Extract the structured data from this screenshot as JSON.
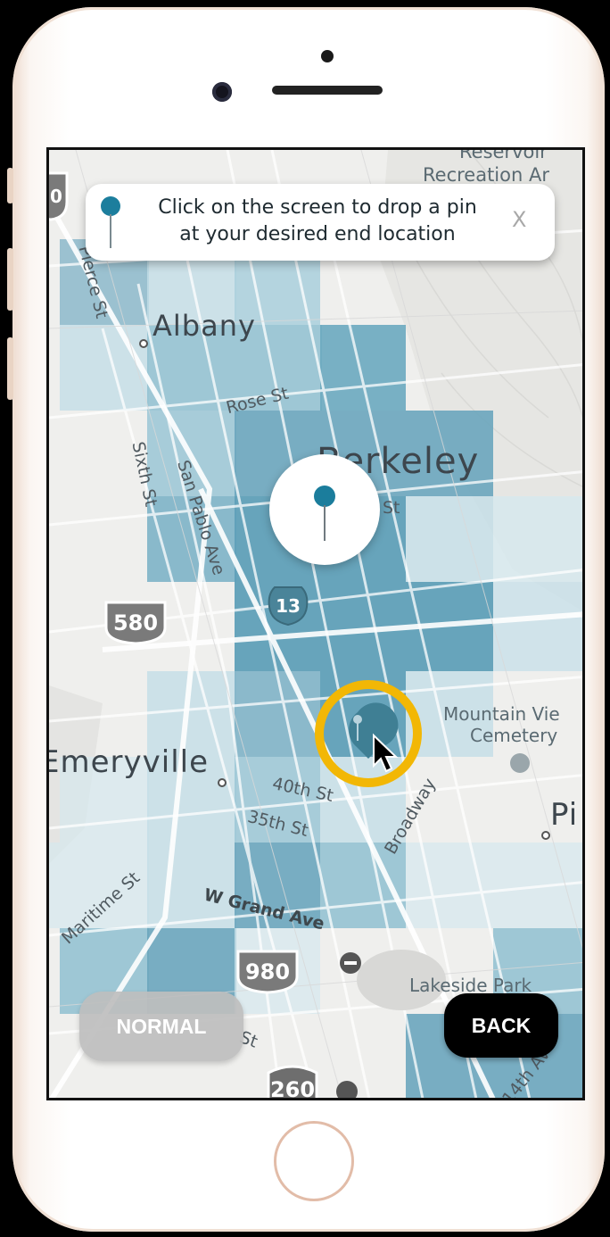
{
  "instruction": {
    "line1": "Click on the screen to drop a pin",
    "line2": "at your desired end location",
    "close_label": "X"
  },
  "map": {
    "cities": {
      "albany": "Albany",
      "berkeley": "Berkeley",
      "emeryville": "Emeryville",
      "piedmont": "Pi"
    },
    "streets": {
      "pierce": "Pierce St",
      "rose": "Rose St",
      "sixth": "Sixth St",
      "san_pablo": "San Pablo Ave",
      "st_fragment": "St",
      "fortieth": "40th St",
      "thirtyfifth": "35th St",
      "broadway": "Broadway",
      "maritime": "Maritime St",
      "w_grand": "W Grand Ave",
      "st_fragment2": "St",
      "fourteenth": "14th Av"
    },
    "pois": {
      "reservoir_line1": "Reservoir",
      "reservoir_line2": "Recreation Ar",
      "cemetery_line1": "Mountain Vie",
      "cemetery_line2": "Cemetery",
      "lakeside": "Lakeside Park"
    },
    "shields": {
      "i580": "580",
      "ca13": "13",
      "i980": "980",
      "i260": "260",
      "top_left": "0"
    },
    "colors": {
      "heat_dark": "#5f9fb8",
      "heat_mid": "#8fbfd0",
      "heat_light": "#c3dde6",
      "accent_pin": "#1b7d9c",
      "highlight_ring": "#f2b705"
    }
  },
  "buttons": {
    "normal": "NORMAL",
    "back": "BACK"
  }
}
